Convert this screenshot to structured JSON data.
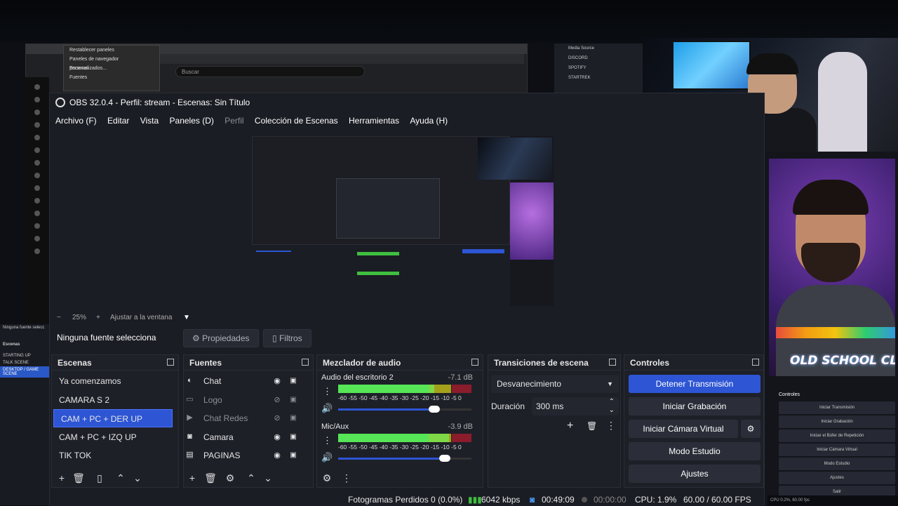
{
  "bg": {
    "context_menu": [
      "Restablecer paneles",
      "Paneles de navegador personalizados...",
      "Escenas",
      "Fuentes"
    ],
    "search_placeholder": "Buscar",
    "mini_sources": [
      "Media Source",
      "DISCORD",
      "SPOTIFY",
      "STARTREK"
    ],
    "left_partial": {
      "label": "Ninguna fuente selecc",
      "scenes_title": "Escenas",
      "items": [
        "STARTING UP",
        "TALK SCENE",
        "DESKTOP / GAME SCENE"
      ]
    },
    "controls_mini": {
      "title": "Controles",
      "items": [
        "Iniciar Transmisión",
        "Iniciar Grabación",
        "Iniciar el Búfer de Repetición",
        "Iniciar Cámara Virtual",
        "Modo Estudio",
        "Ajustes",
        "Salir"
      ]
    },
    "right_status": "CPU 0.2%, 60.00 fps",
    "overlay_logo": "OLD SCHOOL CLUB"
  },
  "window": {
    "title": "OBS 32.0.4 - Perfil: stream - Escenas: Sin Título"
  },
  "menu": [
    "Archivo (F)",
    "Editar",
    "Vista",
    "Paneles (D)",
    "Perfil",
    "Colección de Escenas",
    "Herramientas",
    "Ayuda (H)"
  ],
  "zoom": {
    "minus": "−",
    "value": "25%",
    "plus": "+",
    "fit": "Ajustar a la ventana",
    "caret": "▼"
  },
  "source_bar": {
    "none": "Ninguna fuente seleccionad",
    "props": "Propiedades",
    "filters": "Filtros"
  },
  "scenes": {
    "title": "Escenas",
    "items": [
      "Ya comenzamos",
      "CAMARA S 2",
      "CAM + PC + DER UP",
      "CAM + PC + IZQ UP",
      "TIK TOK"
    ],
    "selected": "CAM + PC + DER UP"
  },
  "sources": {
    "title": "Fuentes",
    "items": [
      {
        "name": "Chat",
        "icon": "browser-icon",
        "visible": true
      },
      {
        "name": "Logo",
        "icon": "image-icon",
        "visible": false
      },
      {
        "name": "Chat Redes",
        "icon": "media-icon",
        "visible": false
      },
      {
        "name": "Camara",
        "icon": "camera-icon",
        "visible": true
      },
      {
        "name": "PAGINAS",
        "icon": "window-icon",
        "visible": true
      }
    ]
  },
  "mixer": {
    "title": "Mezclador de audio",
    "scale": "-60 -55 -50 -45 -40 -35 -30 -25 -20 -15 -10 -5 0",
    "channels": [
      {
        "name": "Audio del escritorio 2",
        "db": "-7.1 dB",
        "level": 0.72,
        "volume": 0.72
      },
      {
        "name": "Mic/Aux",
        "db": "-3.9 dB",
        "level": 0.83,
        "volume": 0.8
      }
    ]
  },
  "transitions": {
    "title": "Transiciones de escena",
    "selected": "Desvanecimiento",
    "duration_label": "Duración",
    "duration_value": "300 ms"
  },
  "controls": {
    "title": "Controles",
    "stop_stream": "Detener Transmisión",
    "start_record": "Iniciar Grabación",
    "virtual_cam": "Iniciar Cámara Virtual",
    "studio": "Modo Estudio",
    "settings": "Ajustes"
  },
  "status": {
    "dropped": "Fotogramas Perdidos 0 (0.0%)",
    "bitrate": "6042 kbps",
    "stream_time": "00:49:09",
    "rec_time": "00:00:00",
    "cpu": "CPU: 1.9%",
    "fps": "60.00 / 60.00 FPS"
  },
  "colors": {
    "accent": "#2d55d4",
    "meter_green": "#3fbf3f",
    "meter_yellow": "#a5a01a",
    "meter_red": "#8a1c2c"
  }
}
